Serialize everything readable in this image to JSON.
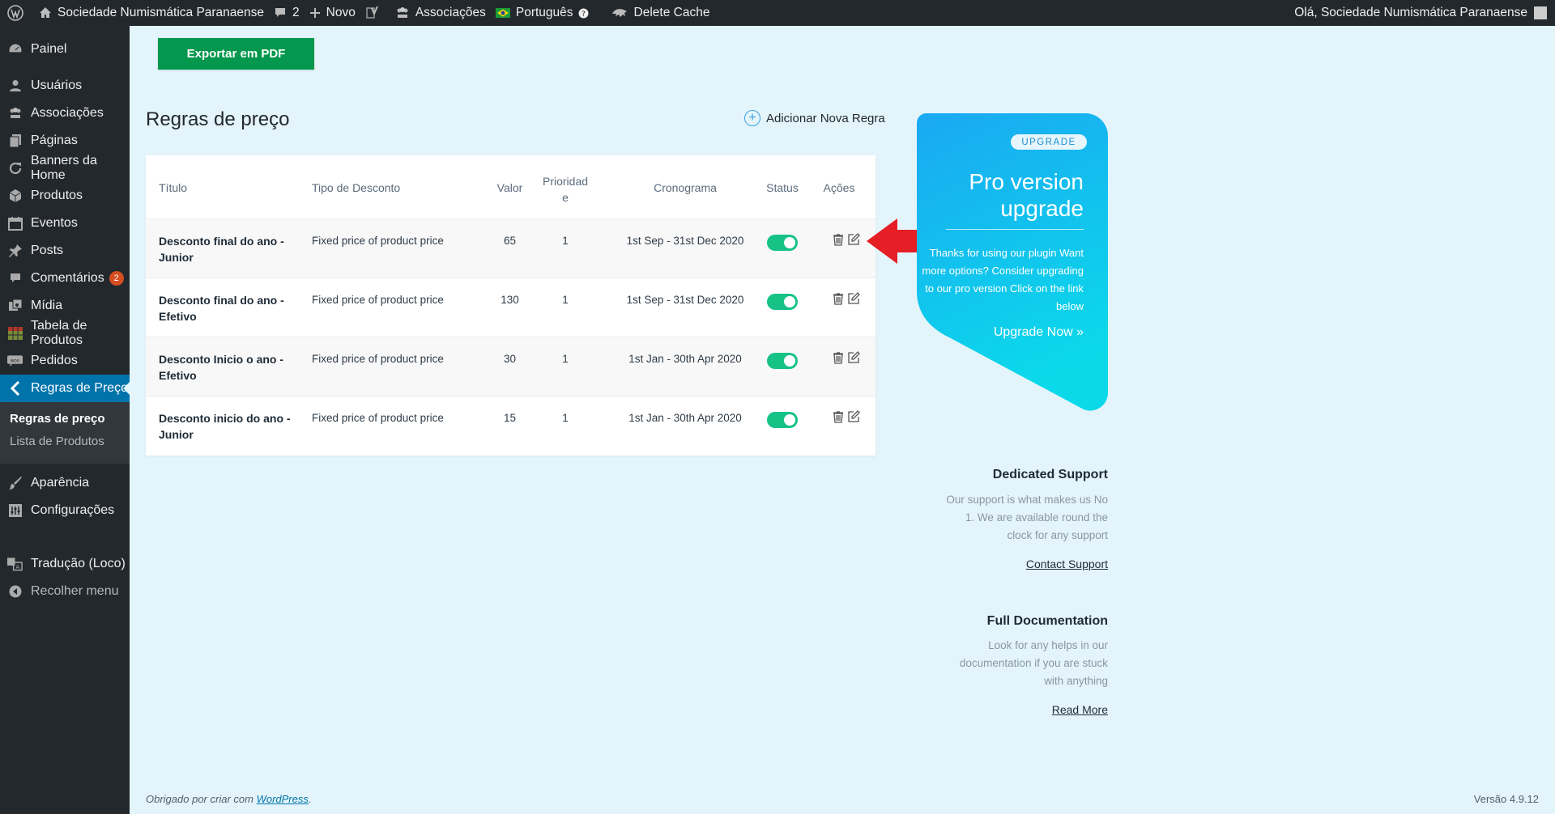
{
  "adminbar": {
    "site_name": "Sociedade Numismática Paranaense",
    "comments_count": "2",
    "new_label": "Novo",
    "associations_label": "Associações",
    "language_label": "Português",
    "delete_cache_label": "Delete Cache",
    "greeting": "Olá, Sociedade Numismática Paranaense"
  },
  "sidebar": {
    "items": [
      {
        "label": "Painel",
        "icon": "dashboard-icon"
      },
      {
        "label": "Usuários",
        "icon": "users-icon"
      },
      {
        "label": "Associações",
        "icon": "groups-icon"
      },
      {
        "label": "Páginas",
        "icon": "pages-icon"
      },
      {
        "label": "Banners da Home",
        "icon": "update-icon"
      },
      {
        "label": "Produtos",
        "icon": "products-icon"
      },
      {
        "label": "Eventos",
        "icon": "calendar-icon"
      },
      {
        "label": "Posts",
        "icon": "pin-icon"
      },
      {
        "label": "Comentários",
        "icon": "comments-icon",
        "badge": "2"
      },
      {
        "label": "Mídia",
        "icon": "media-icon"
      },
      {
        "label": "Tabela de Produtos",
        "icon": "table-icon"
      },
      {
        "label": "Pedidos",
        "icon": "woo-icon"
      },
      {
        "label": "Regras de Preço",
        "icon": "chevron-left-icon"
      },
      {
        "label": "Aparência",
        "icon": "brush-icon"
      },
      {
        "label": "Configurações",
        "icon": "settings-icon"
      },
      {
        "label": "Tradução (Loco)",
        "icon": "translation-icon"
      },
      {
        "label": "Recolher menu",
        "icon": "collapse-icon"
      }
    ],
    "submenu": [
      "Regras de preço",
      "Lista de Produtos"
    ]
  },
  "main": {
    "export_label": "Exportar em PDF",
    "title": "Regras de preço",
    "add_rule_label": "Adicionar Nova Regra"
  },
  "table": {
    "headers": [
      "Título",
      "Tipo de Desconto",
      "Valor",
      "Prioridad\ne",
      "Cronograma",
      "Status",
      "Ações"
    ],
    "rows": [
      {
        "title": "Desconto final do ano - Junior",
        "type": "Fixed price of product price",
        "value": "65",
        "priority": "1",
        "schedule": "1st Sep - 31st Dec 2020",
        "status": true
      },
      {
        "title": "Desconto final do ano - Efetivo",
        "type": "Fixed price of product price",
        "value": "130",
        "priority": "1",
        "schedule": "1st Sep - 31st Dec 2020",
        "status": true
      },
      {
        "title": "Desconto Inicio o ano - Efetivo",
        "type": "Fixed price of product price",
        "value": "30",
        "priority": "1",
        "schedule": "1st Jan - 30th Apr 2020",
        "status": true
      },
      {
        "title": "Desconto inicio do ano - Junior",
        "type": "Fixed price of product price",
        "value": "15",
        "priority": "1",
        "schedule": "1st Jan - 30th Apr 2020",
        "status": true
      }
    ]
  },
  "upgrade": {
    "badge": "UPGRADE",
    "title": "Pro version upgrade",
    "description": "Thanks for using our plugin Want more options? Consider upgrading to our pro version Click on the link below",
    "link": "Upgrade Now »"
  },
  "support": {
    "title": "Dedicated Support",
    "text": "Our support is what makes us No 1. We are available round the clock for any support",
    "link": "Contact Support"
  },
  "docs": {
    "title": "Full Documentation",
    "text": "Look for any helps in our documentation if you are stuck with anything",
    "link": "Read More"
  },
  "footer": {
    "thanks_prefix": "Obrigado por criar com",
    "wordpress_link": "WordPress",
    "version": "Versão 4.9.12"
  },
  "colors": {
    "admin_bg": "#23282d",
    "active_menu": "#0073aa",
    "export_green": "#03984d",
    "toggle_on": "#17c286",
    "upgrade_gradient_start": "#1aa8f2",
    "upgrade_gradient_end": "#0bd9ea",
    "arrow_red": "#e61e26"
  }
}
